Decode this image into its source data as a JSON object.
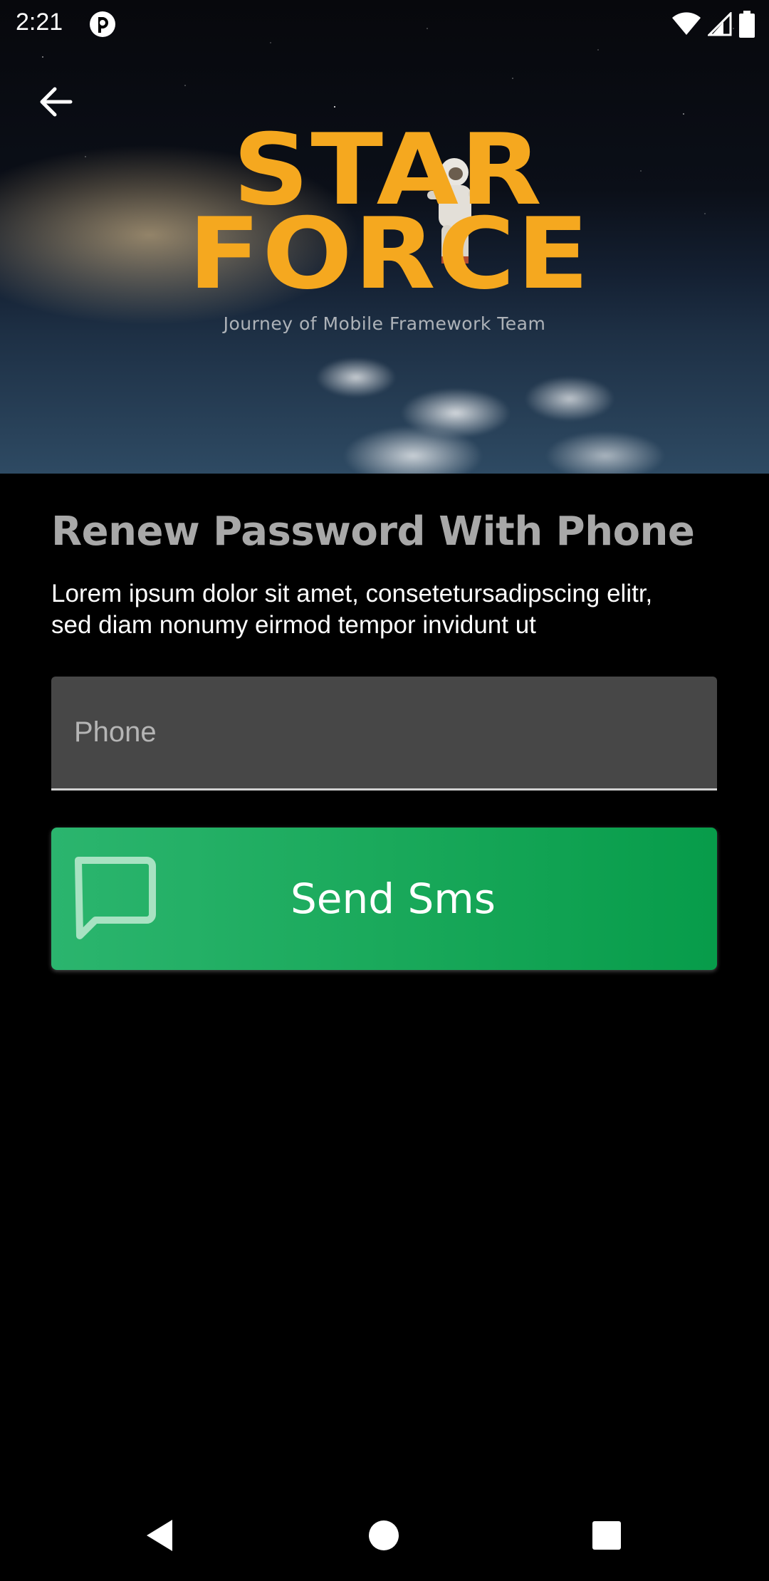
{
  "status_bar": {
    "time": "2:21"
  },
  "hero": {
    "logo_line1": "STAR",
    "logo_line2": "FORCE",
    "tagline": "Journey of Mobile Framework Team"
  },
  "form": {
    "title": "Renew Password With Phone",
    "description": "Lorem ipsum dolor sit amet, consetetursadipscing elitr, sed diam nonumy eirmod tempor invidunt ut",
    "phone_placeholder": "Phone",
    "phone_value": "",
    "send_label": "Send Sms"
  },
  "colors": {
    "logo": "#f5a81f",
    "button_start": "#2bb56e",
    "button_end": "#079c4a",
    "field_bg": "#474747",
    "title": "#a8a8a8"
  },
  "icons": {
    "back": "arrow-left-icon",
    "sms": "chat-bubble-icon",
    "status_app": "app-notification-icon",
    "wifi": "wifi-icon",
    "signal": "cell-signal-icon",
    "battery": "battery-icon",
    "nav_back": "triangle-back-icon",
    "nav_home": "circle-home-icon",
    "nav_recent": "square-recents-icon"
  }
}
